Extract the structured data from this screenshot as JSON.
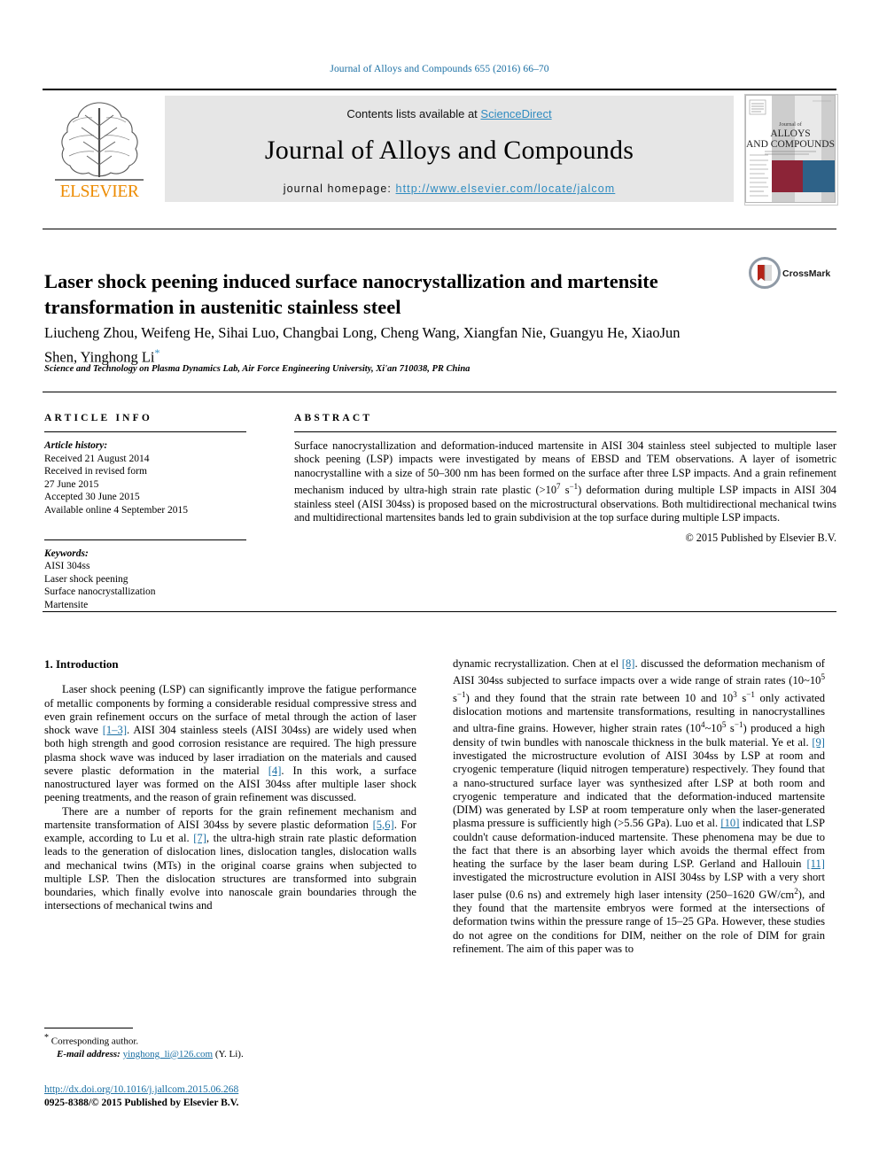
{
  "running_head": "Journal of Alloys and Compounds 655 (2016) 66–70",
  "masthead": {
    "contents_prefix": "Contents lists available at ",
    "sciencedirect": "ScienceDirect",
    "journal_title": "Journal of Alloys and Compounds",
    "homepage_prefix": "journal homepage: ",
    "homepage_url": "http://www.elsevier.com/locate/jalcom",
    "publisher_name": "ELSEVIER",
    "cover": {
      "line1": "Journal of",
      "line2": "ALLOYS",
      "line3": "AND COMPOUNDS",
      "band_left_color": "#8c2437",
      "band_right_color": "#2e6288",
      "accent_color": "#1a6fa3"
    }
  },
  "title": "Laser shock peening induced surface nanocrystallization and martensite transformation in austenitic stainless steel",
  "authors": "Liucheng Zhou, Weifeng He, Sihai Luo, Changbai Long, Cheng Wang, Xiangfan Nie, Guangyu He, XiaoJun Shen, Yinghong Li",
  "author_marker": "*",
  "affiliation": "Science and Technology on Plasma Dynamics Lab, Air Force Engineering University, Xi'an 710038, PR China",
  "crossmark": {
    "label": "CrossMark",
    "book_color": "#b32317",
    "ring_color": "#7e8a99"
  },
  "article_info": {
    "heading": "ARTICLE INFO",
    "history_label": "Article history:",
    "history": [
      "Received 21 August 2014",
      "Received in revised form",
      "27 June 2015",
      "Accepted 30 June 2015",
      "Available online 4 September 2015"
    ],
    "keywords_label": "Keywords:",
    "keywords": [
      "AISI 304ss",
      "Laser shock peening",
      "Surface nanocrystallization",
      "Martensite"
    ]
  },
  "abstract": {
    "heading": "ABSTRACT",
    "p1_a": "Surface nanocrystallization and deformation-induced martensite in AISI 304 stainless steel subjected to multiple laser shock peening (LSP) impacts were investigated by means of EBSD and TEM observations. A layer of isometric nanocrystalline with a size of 50–300 nm has been formed on the surface after three LSP impacts. And a grain refinement mechanism induced by ultra-high strain rate plastic (>10",
    "sup1": "7",
    "p1_b": " s",
    "sup2": "−1",
    "p1_c": ") deformation during multiple LSP impacts in AISI 304 stainless steel (AISI 304ss) is proposed based on the microstructural observations. Both multidirectional mechanical twins and multidirectional martensites bands led to grain subdivision at the top surface during multiple LSP impacts.",
    "copyright": "© 2015 Published by Elsevier B.V."
  },
  "body": {
    "section_number_title": "1. Introduction",
    "left": {
      "p1_a": "Laser shock peening (LSP) can significantly improve the fatigue performance of metallic components by forming a considerable residual compressive stress and even grain refinement occurs on the surface of metal through the action of laser shock wave ",
      "ref1": "[1–3]",
      "p1_b": ". AISI 304 stainless steels (AISI 304ss) are widely used when both high strength and good corrosion resistance are required. The high pressure plasma shock wave was induced by laser irradiation on the materials and caused severe plastic deformation in the material ",
      "ref2": "[4]",
      "p1_c": ". In this work, a surface nanostructured layer was formed on the AISI 304ss after multiple laser shock peening treatments, and the reason of grain refinement was discussed.",
      "p2_a": "There are a number of reports for the grain refinement mechanism and martensite transformation of AISI 304ss by severe plastic deformation ",
      "ref3": "[5,6]",
      "p2_b": ". For example, according to Lu et al. ",
      "ref4": "[7]",
      "p2_c": ", the ultra-high strain rate plastic deformation leads to the generation of dislocation lines, dislocation tangles, dislocation walls and mechanical twins (MTs) in the original coarse grains when subjected to multiple LSP. Then the dislocation structures are transformed into subgrain boundaries, which finally evolve into nanoscale grain boundaries through the intersections of mechanical twins and"
    },
    "right": {
      "p1_a": "dynamic recrystallization. Chen at el ",
      "ref8": "[8]",
      "p1_b": ". discussed the deformation mechanism of AISI 304ss subjected to surface impacts over a wide range of strain rates (10~10",
      "sup_a": "5",
      "p1_c": " s",
      "sup_b": "−1",
      "p1_d": ") and they found that the strain rate between 10 and 10",
      "sup_c": "3",
      "p1_e": " s",
      "sup_d": "−1",
      "p1_f": " only activated dislocation motions and martensite transformations, resulting in nanocrystallines and ultra-fine grains. However, higher strain rates (10",
      "sup_e": "4",
      "p1_g": "~10",
      "sup_f": "5",
      "p1_h": " s",
      "sup_g": "−1",
      "p1_i": ") produced a high density of twin bundles with nanoscale thickness in the bulk material. Ye et al. ",
      "ref9": "[9]",
      "p1_j": " investigated the microstructure evolution of AISI 304ss by LSP at room and cryogenic temperature (liquid nitrogen temperature) respectively. They found that a nano-structured surface layer was synthesized after LSP at both room and cryogenic temperature and indicated that the deformation-induced martensite (DIM) was generated by LSP at room temperature only when the laser-generated plasma pressure is sufficiently high (>5.56 GPa). Luo et al. ",
      "ref10": "[10]",
      "p1_k": " indicated that LSP couldn't cause deformation-induced martensite. These phenomena may be due to the fact that there is an absorbing layer which avoids the thermal effect from heating the surface by the laser beam during LSP. Gerland and Hallouin ",
      "ref11": "[11]",
      "p1_l": " investigated the microstructure evolution in AISI 304ss by LSP with a very short laser pulse (0.6 ns) and extremely high laser intensity (250–1620 GW/cm",
      "sup_h": "2",
      "p1_m": "), and they found that the martensite embryos were formed at the intersections of deformation twins within the pressure range of 15–25 GPa. However, these studies do not agree on the conditions for DIM, neither on the role of DIM for grain refinement. The aim of this paper was to"
    }
  },
  "footnote": {
    "star": "*",
    "corresponding": " Corresponding author.",
    "email_label": "E-mail address:",
    "email": "yinghong_li@126.com",
    "email_suffix": " (Y. Li)."
  },
  "doi_block": {
    "doi": "http://dx.doi.org/10.1016/j.jallcom.2015.06.268",
    "issn_copyright": "0925-8388/© 2015 Published by Elsevier B.V."
  }
}
